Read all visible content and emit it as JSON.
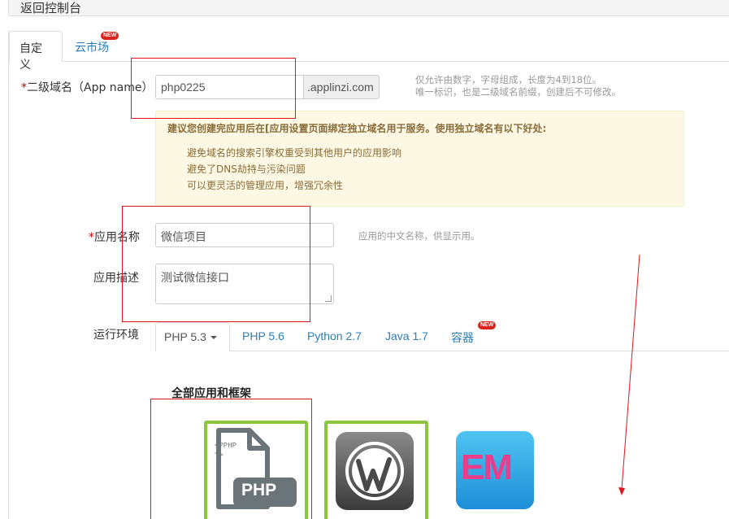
{
  "top": {
    "back_label": "返回控制台"
  },
  "tabs": [
    {
      "label": "自定义",
      "active": true
    },
    {
      "label": "云市场",
      "badge": "NEW"
    }
  ],
  "form": {
    "subdomain": {
      "label": "二级域名（App name）",
      "required_mark": "*",
      "value": "php0225",
      "suffix": ".applinzi.com",
      "hint_line1": "仅允许由数字，字母组成，长度为4到18位。",
      "hint_line2": "唯一标识，也是二级域名前缀，创建后不可修改。"
    },
    "notice": {
      "title": "建议您创建完应用后在[应用设置页面绑定独立域名用于服务。使用独立域名有以下好处:",
      "items": [
        "避免域名的搜索引擎权重受到其他用户的应用影响",
        "避免了DNS劫持与污染问题",
        "可以更灵活的管理应用，增强冗余性"
      ]
    },
    "app_name": {
      "label": "应用名称",
      "required_mark": "*",
      "value": "微信项目",
      "hint": "应用的中文名称，供显示用。"
    },
    "app_desc": {
      "label": "应用描述",
      "value": "测试微信接口"
    },
    "runtime": {
      "label": "运行环境",
      "tabs": [
        {
          "label": "PHP 5.3",
          "active": true,
          "dropdown": true
        },
        {
          "label": "PHP 5.6"
        },
        {
          "label": "Python 2.7"
        },
        {
          "label": "Java 1.7"
        },
        {
          "label": "容器",
          "badge": "NEW"
        }
      ]
    }
  },
  "apps": {
    "section_title": "全部应用和框架",
    "items": [
      {
        "icon": "php-file-icon",
        "text": "PHP",
        "small_text": "<?PHP ?>",
        "selected": true
      },
      {
        "icon": "wordpress-icon",
        "selected": true
      },
      {
        "icon": "em-icon",
        "text": "EM",
        "selected": false
      }
    ]
  },
  "colors": {
    "link": "#2a7fb8",
    "annotation_red": "#e0161c",
    "selected_green": "#8cc63f",
    "alert_bg": "#fcf8e3",
    "alert_text": "#8a6d3b"
  }
}
